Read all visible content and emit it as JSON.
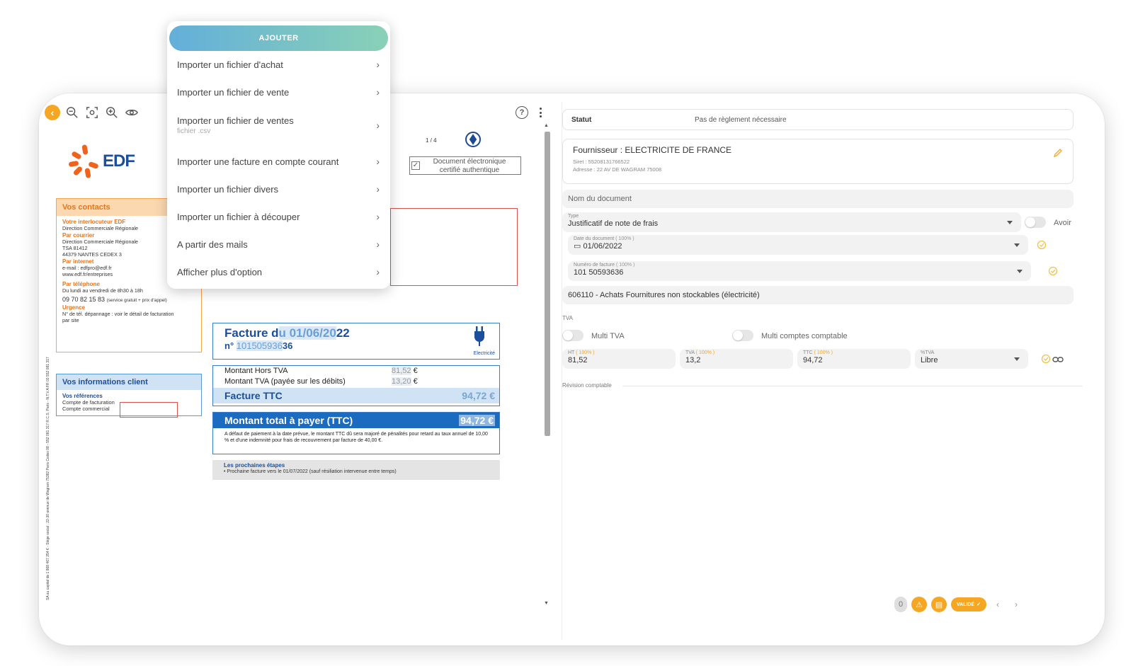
{
  "viewer": {
    "page_indicator": "1 / 4",
    "cert_line1": "Document électronique",
    "cert_line2": "certifié authentique",
    "side_text": "SA au capital de 1 868 467 354 € - Siège social : 22-30 avenue de Wagram 75382 Paris Cedex 08 - 552 081 317 R.C.S. Paris - N.T.V.A FR 03 552 081 317",
    "doc": {
      "logo_text": "EDF",
      "contacts": {
        "title": "Vos contacts",
        "interlocuteur_label": "Votre interlocuteur EDF",
        "interlocuteur": "Direction Commerciale Régionale",
        "courrier_label": "Par courrier",
        "courrier_1": "Direction Commerciale Régionale",
        "courrier_2": "TSA 81412",
        "courrier_3": "44379 NANTES CEDEX 3",
        "internet_label": "Par internet",
        "internet_1": "e-mail : edfpro@edf.fr",
        "internet_2": "www.edf.fr/entreprises",
        "tel_label": "Par téléphone",
        "tel_hours": "Du lundi au vendredi de 8h30 à 18h",
        "tel_number": "09 70 82 15 83",
        "tel_note": "(service gratuit + prix d'appel)",
        "urgence_label": "Urgence",
        "urgence_1": "N° de tél. dépannage : voir le détail de facturation",
        "urgence_2": "par site"
      },
      "client": {
        "title": "Vos informations client",
        "refs_label": "Vos références",
        "ref_1": "Compte de facturation",
        "ref_2": "Compte commercial"
      },
      "facture": {
        "title_prefix": "Facture d",
        "title_hl": "u 01/06/20",
        "title_suffix": "22",
        "number_prefix": "n°",
        "number_hl": "101505936",
        "number_suffix": "36",
        "plug_label": "Electricité"
      },
      "amounts": {
        "ht_label": "Montant Hors TVA",
        "ht_value": "81,52",
        "tva_label": "Montant TVA (payée sur les débits)",
        "tva_value": "13,20",
        "currency": "€",
        "ttc_label": "Facture TTC",
        "ttc_value": "94,72 €"
      },
      "total": {
        "label": "Montant total à payer (TTC)",
        "value": "94,72",
        "currency": "€",
        "note": "A défaut de paiement à la date prévue, le montant TTC dû sera majoré de pénalités pour retard au taux annuel de 10,00 % et d'une indemnité pour frais de recouvrement par facture de 40,00 €."
      },
      "steps": {
        "title": "Les prochaines étapes",
        "text": "• Prochaine facture vers le 01/07/2022 (sauf résiliation intervenue entre temps)"
      }
    }
  },
  "menu": {
    "add_label": "AJOUTER",
    "items": [
      {
        "label": "Importer un fichier d'achat",
        "sub": ""
      },
      {
        "label": "Importer un fichier de vente",
        "sub": ""
      },
      {
        "label": "Importer un fichier de ventes",
        "sub": "fichier .csv"
      },
      {
        "label": "Importer une facture en compte courant",
        "sub": ""
      },
      {
        "label": "Importer un fichier divers",
        "sub": ""
      },
      {
        "label": "Importer un fichier à découper",
        "sub": ""
      },
      {
        "label": "A partir des mails",
        "sub": ""
      },
      {
        "label": "Afficher plus d'option",
        "sub": ""
      }
    ]
  },
  "form": {
    "statut_label": "Statut",
    "statut_value": "Pas de règlement nécessaire",
    "supplier_name": "Fournisseur : ELECTRICITE DE FRANCE",
    "supplier_siret": "Siret : 55208131766522",
    "supplier_address": "Adresse : 22 AV DE WAGRAM 75008",
    "doc_name_placeholder": "Nom du document",
    "type_label": "Type",
    "type_value": "Justificatif de note de frais",
    "avoir_label": "Avoir",
    "date_label": "Date du document",
    "date_pct": "( 100% )",
    "date_value": "01/06/2022",
    "invoice_label": "Numéro de facture",
    "invoice_pct": "( 100% )",
    "invoice_value": "101 50593636",
    "account_value": "606110 - Achats Fournitures non stockables (électricité)",
    "tva_section": "TVA",
    "multi_tva_label": "Multi TVA",
    "multi_comptes_label": "Multi comptes comptable",
    "ht_label": "HT",
    "ht_pct": "( 100% )",
    "ht_value": "81,52",
    "tva_label": "TVA",
    "tva_pct": "( 100% )",
    "tva_value": "13,2",
    "ttc_label": "TTC",
    "ttc_pct": "( 100% )",
    "ttc_value": "94,72",
    "pct_tva_label": "%TVA",
    "pct_tva_value": "Libre",
    "revision_label": "Révision comptable",
    "valide_label": "VALIDÉ",
    "badge_count": "0"
  },
  "colors": {
    "accent_orange": "#f5a623",
    "edf_blue": "#1b4f9c",
    "edf_orange": "#f0631a",
    "add_gradient_start": "#63afd9",
    "add_gradient_end": "#89d1b7"
  }
}
